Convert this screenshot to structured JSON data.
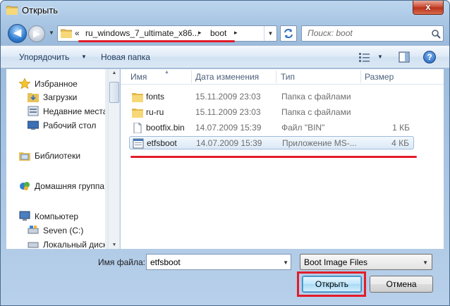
{
  "window": {
    "title": "Открыть",
    "close_glyph": "x"
  },
  "address": {
    "overflow_glyph": "«",
    "segments": [
      "ru_windows_7_ultimate_x86...",
      "boot"
    ],
    "separator": "▸"
  },
  "search": {
    "placeholder": "Поиск: boot"
  },
  "toolbar": {
    "organize_label": "Упорядочить",
    "new_folder_label": "Новая папка",
    "help_glyph": "?"
  },
  "nav": {
    "items": [
      {
        "label": "Избранное",
        "icon": "star-icon"
      },
      {
        "label": "Загрузки",
        "icon": "downloads-folder-icon"
      },
      {
        "label": "Недавние места",
        "icon": "recent-places-icon"
      },
      {
        "label": "Рабочий стол",
        "icon": "desktop-icon"
      },
      {
        "label": "Библиотеки",
        "icon": "libraries-icon"
      },
      {
        "label": "Домашняя группа",
        "icon": "homegroup-icon"
      },
      {
        "label": "Компьютер",
        "icon": "computer-icon"
      },
      {
        "label": "Seven (C:)",
        "icon": "drive-icon"
      },
      {
        "label": "Локальный диск",
        "icon": "drive-icon"
      }
    ]
  },
  "columns": {
    "name": "Имя",
    "date": "Дата изменения",
    "type": "Тип",
    "size": "Размер"
  },
  "files": [
    {
      "name": "fonts",
      "date": "15.11.2009 23:03",
      "type": "Папка с файлами",
      "size": "",
      "icon": "folder-icon"
    },
    {
      "name": "ru-ru",
      "date": "15.11.2009 23:03",
      "type": "Папка с файлами",
      "size": "",
      "icon": "folder-icon"
    },
    {
      "name": "bootfix.bin",
      "date": "14.07.2009 15:39",
      "type": "Файл \"BIN\"",
      "size": "1 КБ",
      "icon": "file-icon"
    },
    {
      "name": "etfsboot",
      "date": "14.07.2009 15:39",
      "type": "Приложение MS-...",
      "size": "4 КБ",
      "icon": "application-icon",
      "selected": true
    }
  ],
  "bottom": {
    "filename_label": "Имя файла:",
    "filename_value": "etfsboot",
    "filetype_value": "Boot Image Files",
    "open_label": "Открыть",
    "cancel_label": "Отмена"
  },
  "colors": {
    "highlight_red": "#e11d2a",
    "selection_border": "#9ebadd"
  }
}
